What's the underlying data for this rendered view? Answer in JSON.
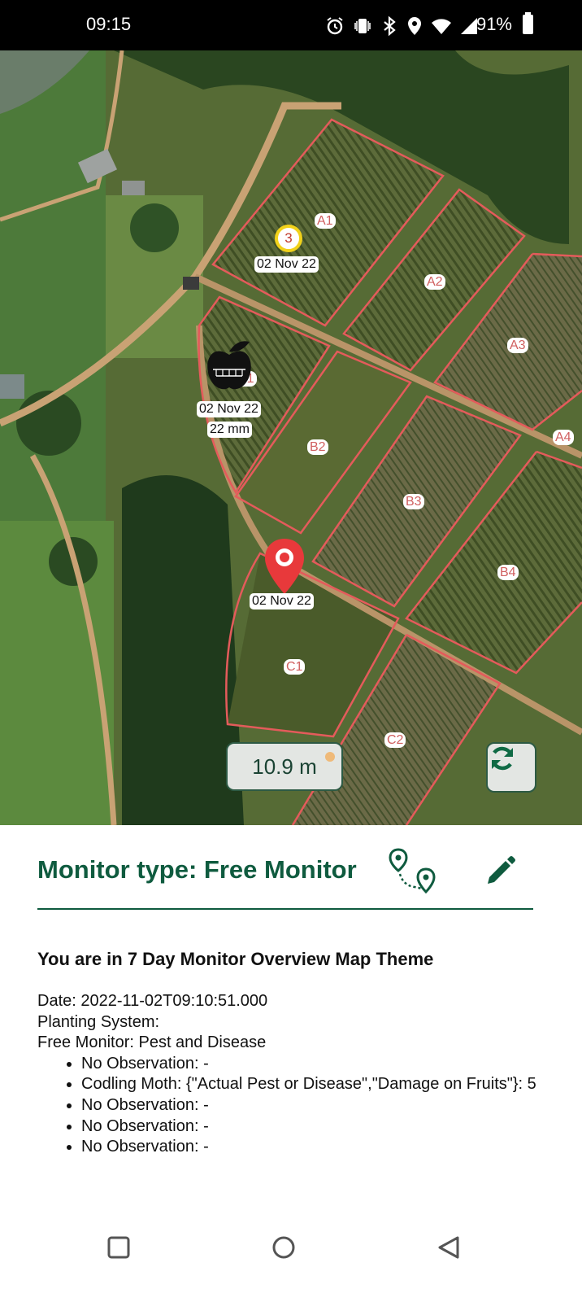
{
  "status_bar": {
    "time": "09:15",
    "battery": "91%",
    "icons": [
      "alarm-icon",
      "vibrate-icon",
      "bluetooth-icon",
      "location-icon",
      "wifi-icon",
      "signal-icon",
      "battery-icon"
    ]
  },
  "map": {
    "blocks": [
      "A1",
      "A2",
      "A3",
      "A4",
      "B1",
      "B2",
      "B3",
      "B4",
      "C1",
      "C2"
    ],
    "markers": {
      "cluster_count": "3",
      "cluster_date": "02 Nov 22",
      "fruit_date": "02 Nov 22",
      "fruit_measure": "22 mm",
      "pin_date": "02 Nov 22"
    },
    "distance": "10.9 m",
    "colors": {
      "block_outline": "#e45b5b",
      "pin": "#e8393b",
      "cluster_ring": "#f2d21a"
    }
  },
  "panel": {
    "monitor_type_label": "Monitor type: Free Monitor",
    "theme_line": "You are in 7 Day Monitor Overview Map Theme",
    "date_line": "Date: 2022-11-02T09:10:51.000",
    "planting_system_line": "Planting System:",
    "free_monitor_line": "Free Monitor: Pest and Disease",
    "observations": [
      "No Observation: -",
      "Codling Moth: {\"Actual Pest or Disease\",\"Damage on Fruits\"}: 5",
      "No Observation: -",
      "No Observation: -",
      "No Observation: -"
    ],
    "accent_color": "#0f5b3f"
  },
  "nav": {
    "icons": [
      "recent-apps-icon",
      "home-icon",
      "back-icon"
    ]
  }
}
